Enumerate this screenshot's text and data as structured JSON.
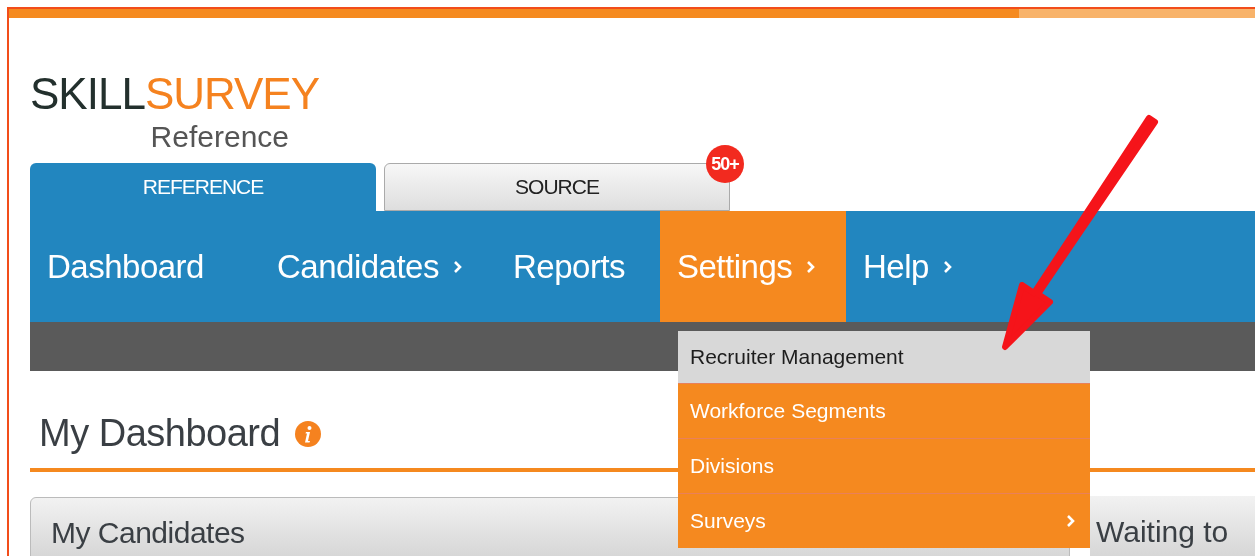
{
  "logo": {
    "brand_dark": "SKILL",
    "brand_accent": "SURVEY",
    "product": "Reference"
  },
  "product_tabs": [
    {
      "label": "REFERENCE",
      "selected": true
    },
    {
      "label": "SOURCE",
      "selected": false,
      "badge": "50+"
    }
  ],
  "nav": [
    {
      "label": "Dashboard",
      "selected": false,
      "submenu": false
    },
    {
      "label": "Candidates",
      "selected": false,
      "submenu": true
    },
    {
      "label": "Reports",
      "selected": false,
      "submenu": false
    },
    {
      "label": "Settings",
      "selected": true,
      "submenu": true
    },
    {
      "label": "Help",
      "selected": false,
      "submenu": true
    }
  ],
  "settings_menu": [
    {
      "label": "Recruiter Management",
      "selected": true,
      "submenu": false
    },
    {
      "label": "Workforce Segments",
      "selected": false,
      "submenu": false
    },
    {
      "label": "Divisions",
      "selected": false,
      "submenu": false
    },
    {
      "label": "Surveys",
      "selected": false,
      "submenu": true
    }
  ],
  "page_title": "My Dashboard",
  "panels": [
    {
      "title": "My Candidates"
    },
    {
      "title": "Waiting to"
    }
  ]
}
